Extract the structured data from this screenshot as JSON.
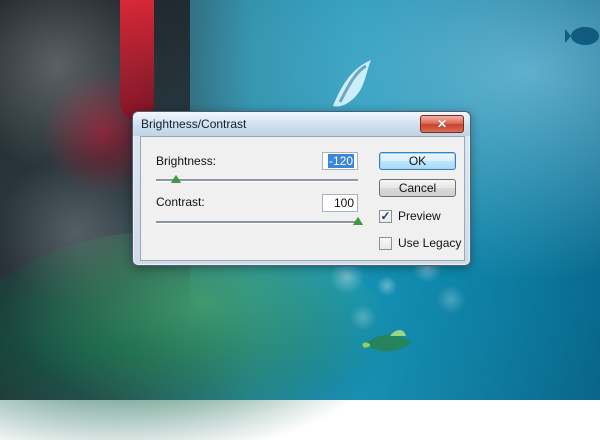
{
  "dialog": {
    "title": "Brightness/Contrast",
    "close_icon": "close-icon",
    "brightness": {
      "label": "Brightness:",
      "value": "-120",
      "slider_fraction": 0.1
    },
    "contrast": {
      "label": "Contrast:",
      "value": "100",
      "slider_fraction": 1.0
    },
    "buttons": {
      "ok": "OK",
      "cancel": "Cancel"
    },
    "checkboxes": {
      "preview": {
        "label": "Preview",
        "checked": true
      },
      "use_legacy": {
        "label": "Use Legacy",
        "checked": false
      }
    }
  },
  "colors": {
    "slider_thumb": "#3d9a3d",
    "selection": "#3b86d6",
    "close_button": "#d45a45"
  }
}
